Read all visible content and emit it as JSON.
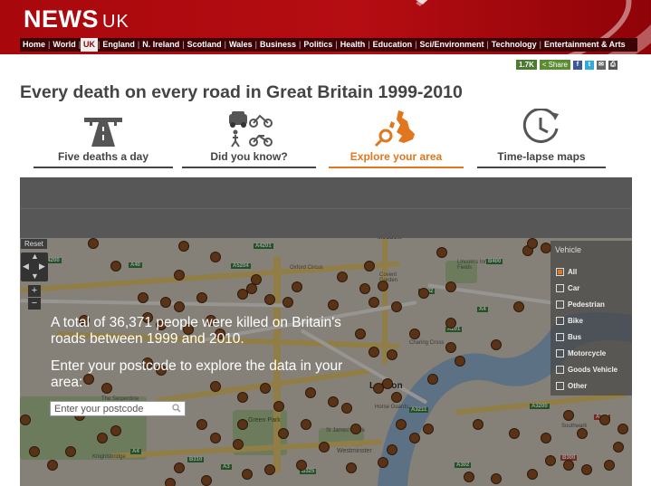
{
  "header": {
    "logo_main": "NEWS",
    "logo_sub": "UK",
    "nav": [
      "Home",
      "World",
      "UK",
      "England",
      "N. Ireland",
      "Scotland",
      "Wales",
      "Business",
      "Politics",
      "Health",
      "Education",
      "Sci/Environment",
      "Technology",
      "Entertainment & Arts"
    ],
    "active_nav": "UK"
  },
  "share": {
    "count": "1.7K",
    "label": "Share",
    "icons": [
      "facebook-icon",
      "twitter-icon",
      "email-icon",
      "print-icon"
    ]
  },
  "headline": "Every death on every road in Great Britain 1999-2010",
  "tabs": [
    {
      "label": "Five deaths a day",
      "icon": "motorway-icon",
      "active": false
    },
    {
      "label": "Did you know?",
      "icon": "vehicles-icon",
      "active": false
    },
    {
      "label": "Explore your area",
      "icon": "uk-map-search-icon",
      "active": true
    },
    {
      "label": "Time-lapse maps",
      "icon": "clock-icon",
      "active": false
    }
  ],
  "map": {
    "reset_label": "Reset",
    "zoom_in": "+",
    "zoom_out": "−",
    "vehicle_title": "Vehicle",
    "vehicle_options": [
      {
        "label": "All",
        "checked": true
      },
      {
        "label": "Car",
        "checked": false
      },
      {
        "label": "Pedestrian",
        "checked": false
      },
      {
        "label": "Bike",
        "checked": false
      },
      {
        "label": "Bus",
        "checked": false
      },
      {
        "label": "Motorcycle",
        "checked": false
      },
      {
        "label": "Goods Vehicle",
        "checked": false
      },
      {
        "label": "Other",
        "checked": false
      }
    ],
    "labels": {
      "london": "London",
      "museum": "MUSEUM",
      "horse_guards": "Horse\nGuards",
      "green_park": "Green Park",
      "westminster": "Westminster",
      "lincolns_inn": "Lincoln's Inn Fields",
      "oxford_circus": "Oxford Circus",
      "st_james": "St James's Park",
      "knightsbridge": "Knightsbridge",
      "the_serpentine": "The Serpentine",
      "charing_cross": "Charing Cross",
      "covent_garden": "Covent Garden",
      "southwark": "Southwark"
    },
    "road_labels": [
      "A4201",
      "A5204",
      "A40",
      "A4",
      "B482",
      "B400",
      "A3211",
      "A3200",
      "A302",
      "B325",
      "A4",
      "B310",
      "A202",
      "B300",
      "A3",
      "A201",
      "A4200"
    ]
  },
  "info": {
    "line1": "A total of 36,371 people were killed on Britain's",
    "line2": "roads between 1999 and 2010.",
    "line3": "Enter your postcode to explore the data in your",
    "line4": "area:",
    "postcode_placeholder": "Enter your postcode"
  },
  "colors": {
    "brand_red": "#b50d12",
    "accent_orange": "#e0761d",
    "dot_brown": "#8b4513"
  }
}
